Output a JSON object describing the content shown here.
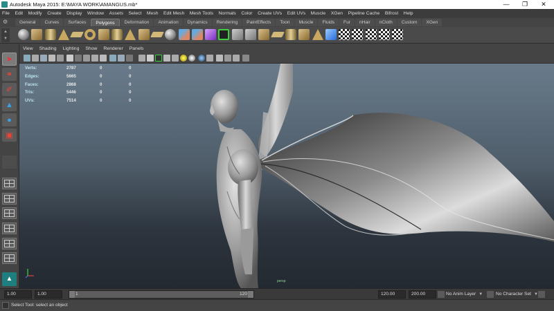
{
  "window": {
    "title": "Autodesk Maya 2015: E:\\MAYA WORK\\AMANGUS.mb*",
    "controls": [
      "minimize",
      "maximize",
      "close"
    ]
  },
  "menubar": [
    "File",
    "Edit",
    "Modify",
    "Create",
    "Display",
    "Window",
    "Assets",
    "Select",
    "Mesh",
    "Edit Mesh",
    "Mesh Tools",
    "Normals",
    "Color",
    "Create UVs",
    "Edit UVs",
    "Muscle",
    "XGen",
    "Pipeline Cache",
    "Bifrost",
    "Help"
  ],
  "shelf": {
    "tabs": [
      "General",
      "Curves",
      "Surfaces",
      "Polygons",
      "Deformation",
      "Animation",
      "Dynamics",
      "Rendering",
      "PaintEffects",
      "Toon",
      "Muscle",
      "Fluids",
      "Fur",
      "nHair",
      "nCloth",
      "Custom",
      "XGen"
    ],
    "active_tab": "Polygons",
    "icons": [
      "poly-sphere-icon",
      "poly-cube-icon",
      "poly-cylinder-icon",
      "poly-cone-icon",
      "poly-plane-icon",
      "poly-torus-icon",
      "poly-cube-icon",
      "poly-cylinder-icon",
      "poly-cone-icon",
      "poly-cube-icon",
      "poly-plane-icon",
      "poly-sphere-icon",
      "combine-icon",
      "separate-icon",
      "purple-cube-icon",
      "green-select-icon",
      "extrude-icon",
      "bridge-icon",
      "poly-cube-icon",
      "poly-plane-icon",
      "poly-cylinder-icon",
      "poly-cube-icon",
      "poly-cone-icon",
      "blue-uv-icon",
      "checker-uv-icon",
      "checker-uv-icon",
      "checker-uv-icon",
      "checker-uv-icon",
      "uv-editor-icon"
    ]
  },
  "viewport": {
    "menu": [
      "View",
      "Shading",
      "Lighting",
      "Show",
      "Renderer",
      "Panels"
    ],
    "hud": [
      {
        "label": "Verts:",
        "v1": "2787",
        "v2": "0",
        "v3": "0"
      },
      {
        "label": "Edges:",
        "v1": "5665",
        "v2": "0",
        "v3": "0"
      },
      {
        "label": "Faces:",
        "v1": "2868",
        "v2": "0",
        "v3": "0"
      },
      {
        "label": "Tris:",
        "v1": "5446",
        "v2": "0",
        "v3": "0"
      },
      {
        "label": "UVs:",
        "v1": "7514",
        "v2": "0",
        "v3": "0"
      }
    ],
    "camera_label": "persp",
    "gradient_colors": [
      "#697b8b",
      "#232930"
    ]
  },
  "timeslider": {
    "start_time": "1.00",
    "playback_start": "1.00",
    "range_start": "1",
    "range_end": "120",
    "playback_end": "120.00",
    "end_time": "200.00",
    "anim_layer": "No Anim Layer",
    "character_set": "No Character Set"
  },
  "status": {
    "message": "Select Tool: select an object"
  }
}
